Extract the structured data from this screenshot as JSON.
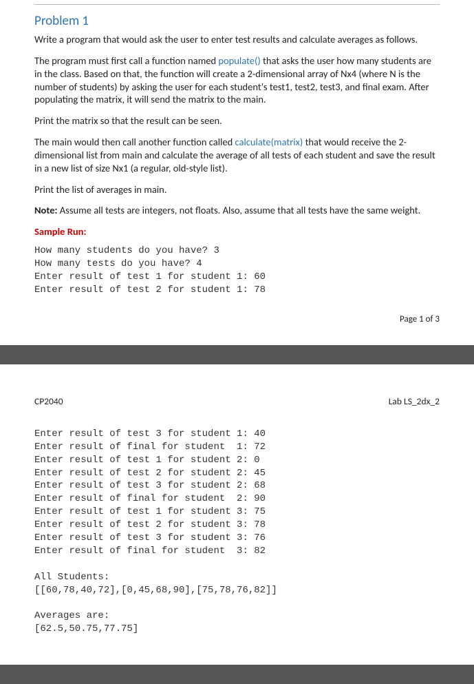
{
  "page1": {
    "title": "Problem 1",
    "p1": "Write a program that would ask the user to enter test results and calculate averages as follows.",
    "p2_a": "The program must first call a function named ",
    "p2_func": "populate()",
    "p2_b": " that asks the user how many students are in the class. Based on that, the function will create a 2-dimensional array of Nx4 (where N is the number of students) by asking the user for each student's test1, test2, test3, and final exam. After populating the matrix, it will send the matrix to the main.",
    "p3": "Print the matrix so that the result can be seen.",
    "p4_a": "The main would then call another function called ",
    "p4_func": "calculate(matrix)",
    "p4_b": " that would receive the 2-dimensional list from main and calculate the average of all tests of each student and save the result in a new list of size Nx1 (a regular, old-style list).",
    "p5": "Print the list of averages in main.",
    "p6_label": "Note:",
    "p6_text": " Assume all tests are integers, not floats. Also, assume that all tests have the same weight.",
    "sample_run_label": "Sample Run:",
    "code1": "How many students do you have? 3\nHow many tests do you have? 4\nEnter result of test 1 for student 1: 60\nEnter result of test 2 for student 1: 78",
    "footer": "Page 1 of 3"
  },
  "page2": {
    "header_left": "CP2040",
    "header_right": "Lab LS_2dx_2",
    "code2": "Enter result of test 3 for student 1: 40\nEnter result of final for student  1: 72\nEnter result of test 1 for student 2: 0\nEnter result of test 2 for student 2: 45\nEnter result of test 3 for student 2: 68\nEnter result of final for student  2: 90\nEnter result of test 1 for student 3: 75\nEnter result of test 2 for student 3: 78\nEnter result of test 3 for student 3: 76\nEnter result of final for student  3: 82\n\nAll Students:\n[[60,78,40,72],[0,45,68,90],[75,78,76,82]]\n\nAverages are:\n[62.5,50.75,77.75]"
  }
}
